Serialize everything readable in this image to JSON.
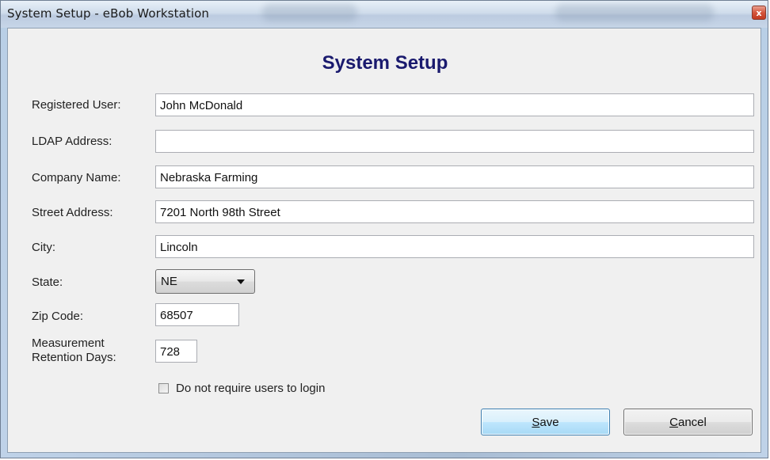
{
  "window": {
    "title": "System Setup - eBob Workstation",
    "close_glyph": "x"
  },
  "header": {
    "title": "System Setup",
    "title_color": "#1a1a6e"
  },
  "form": {
    "registered_user": {
      "label": "Registered User:",
      "value": "John McDonald"
    },
    "ldap_address": {
      "label": "LDAP Address:",
      "value": ""
    },
    "company_name": {
      "label": "Company Name:",
      "value": "Nebraska Farming"
    },
    "street_address": {
      "label": "Street Address:",
      "value": "7201 North 98th Street"
    },
    "city": {
      "label": "City:",
      "value": "Lincoln"
    },
    "state": {
      "label": "State:",
      "value": "NE"
    },
    "zip_code": {
      "label": "Zip Code:",
      "value": "68507"
    },
    "retention": {
      "label_line1": "Measurement",
      "label_line2": "Retention Days:",
      "value": "728"
    },
    "no_login": {
      "label": "Do not require users to login",
      "checked": false
    }
  },
  "buttons": {
    "save": {
      "label_accel": "S",
      "label_rest": "ave"
    },
    "cancel": {
      "label_accel": "C",
      "label_rest": "ancel"
    }
  },
  "icons": {
    "close": "close-icon",
    "dropdown": "chevron-down-icon",
    "checkbox": "checkbox-icon"
  }
}
